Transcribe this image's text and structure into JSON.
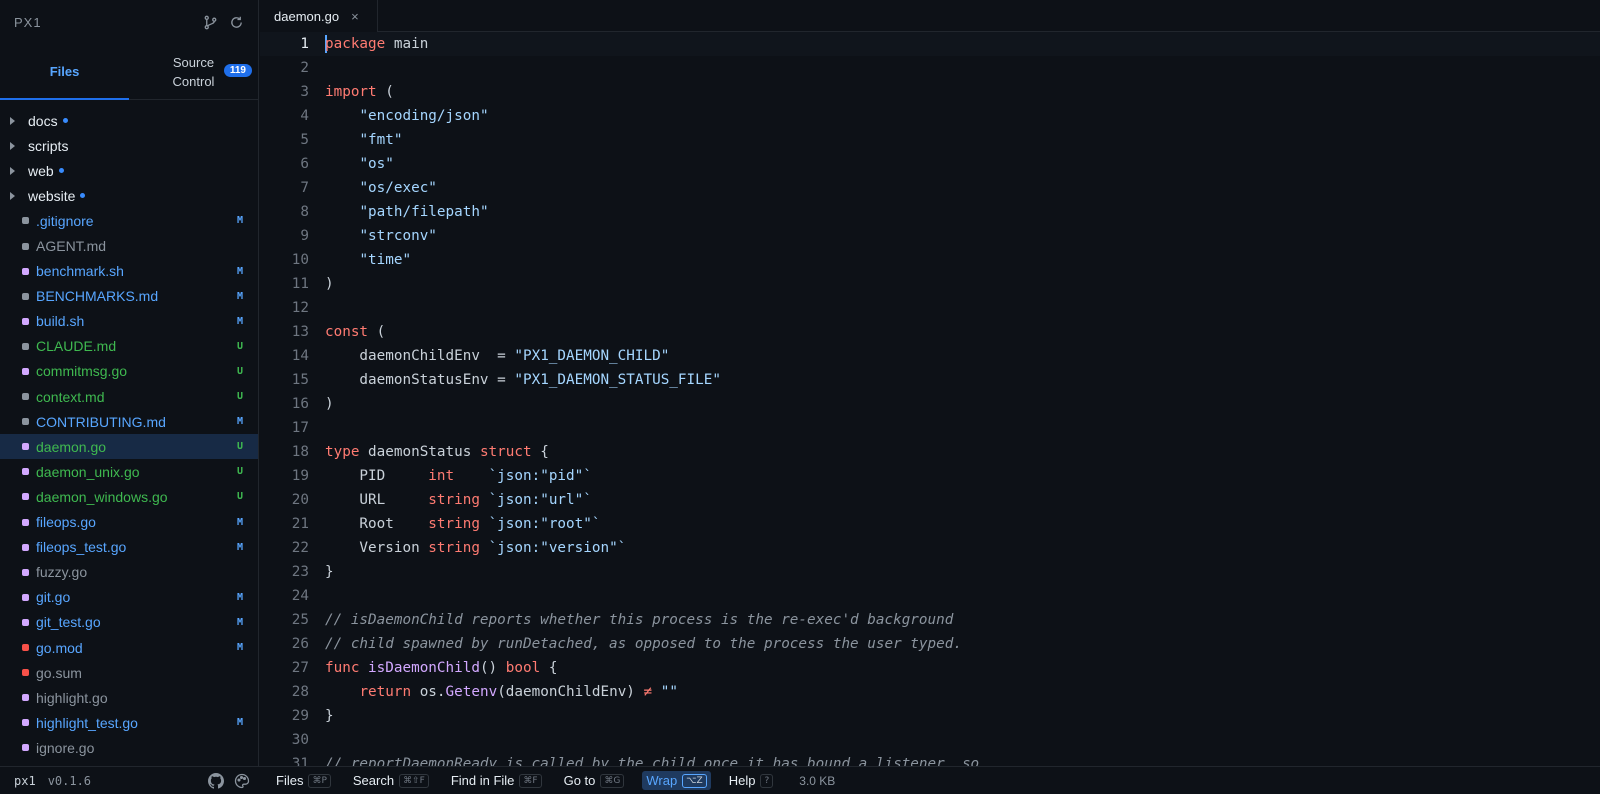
{
  "app": {
    "title": "PX1"
  },
  "sidebar": {
    "tabs": {
      "files": "Files",
      "source_control": "Source\nControl",
      "source_control_l1": "Source",
      "source_control_l2": "Control",
      "badge": "119"
    },
    "items": [
      {
        "type": "folder",
        "name": "docs",
        "dot": true
      },
      {
        "type": "folder",
        "name": "scripts",
        "dot": false
      },
      {
        "type": "folder",
        "name": "web",
        "dot": true
      },
      {
        "type": "folder",
        "name": "website",
        "dot": true
      },
      {
        "type": "file",
        "name": ".gitignore",
        "status": "M",
        "color": "#8b949e"
      },
      {
        "type": "file",
        "name": "AGENT.md",
        "status": "",
        "color": "#8b949e"
      },
      {
        "type": "file",
        "name": "benchmark.sh",
        "status": "M",
        "color": "#d2a8ff"
      },
      {
        "type": "file",
        "name": "BENCHMARKS.md",
        "status": "M",
        "color": "#8b949e"
      },
      {
        "type": "file",
        "name": "build.sh",
        "status": "M",
        "color": "#d2a8ff"
      },
      {
        "type": "file",
        "name": "CLAUDE.md",
        "status": "U",
        "color": "#8b949e"
      },
      {
        "type": "file",
        "name": "commitmsg.go",
        "status": "U",
        "color": "#d2a8ff"
      },
      {
        "type": "file",
        "name": "context.md",
        "status": "U",
        "color": "#8b949e"
      },
      {
        "type": "file",
        "name": "CONTRIBUTING.md",
        "status": "M",
        "color": "#8b949e"
      },
      {
        "type": "file",
        "name": "daemon.go",
        "status": "U",
        "color": "#d2a8ff",
        "selected": true
      },
      {
        "type": "file",
        "name": "daemon_unix.go",
        "status": "U",
        "color": "#d2a8ff"
      },
      {
        "type": "file",
        "name": "daemon_windows.go",
        "status": "U",
        "color": "#d2a8ff"
      },
      {
        "type": "file",
        "name": "fileops.go",
        "status": "M",
        "color": "#d2a8ff"
      },
      {
        "type": "file",
        "name": "fileops_test.go",
        "status": "M",
        "color": "#d2a8ff"
      },
      {
        "type": "file",
        "name": "fuzzy.go",
        "status": "",
        "color": "#d2a8ff"
      },
      {
        "type": "file",
        "name": "git.go",
        "status": "M",
        "color": "#d2a8ff"
      },
      {
        "type": "file",
        "name": "git_test.go",
        "status": "M",
        "color": "#d2a8ff"
      },
      {
        "type": "file",
        "name": "go.mod",
        "status": "M",
        "color": "#f85149"
      },
      {
        "type": "file",
        "name": "go.sum",
        "status": "",
        "color": "#f85149"
      },
      {
        "type": "file",
        "name": "highlight.go",
        "status": "",
        "color": "#d2a8ff"
      },
      {
        "type": "file",
        "name": "highlight_test.go",
        "status": "M",
        "color": "#d2a8ff"
      },
      {
        "type": "file",
        "name": "ignore.go",
        "status": "",
        "color": "#d2a8ff"
      }
    ]
  },
  "editor": {
    "tab": {
      "label": "daemon.go",
      "close": "×"
    },
    "current_line": 1,
    "lines": [
      [
        [
          "kw",
          "package"
        ],
        [
          "t",
          " main"
        ]
      ],
      [],
      [
        [
          "kw",
          "import"
        ],
        [
          "t",
          " ("
        ]
      ],
      [
        [
          "t",
          "    "
        ],
        [
          "str",
          "\"encoding/json\""
        ]
      ],
      [
        [
          "t",
          "    "
        ],
        [
          "str",
          "\"fmt\""
        ]
      ],
      [
        [
          "t",
          "    "
        ],
        [
          "str",
          "\"os\""
        ]
      ],
      [
        [
          "t",
          "    "
        ],
        [
          "str",
          "\"os/exec\""
        ]
      ],
      [
        [
          "t",
          "    "
        ],
        [
          "str",
          "\"path/filepath\""
        ]
      ],
      [
        [
          "t",
          "    "
        ],
        [
          "str",
          "\"strconv\""
        ]
      ],
      [
        [
          "t",
          "    "
        ],
        [
          "str",
          "\"time\""
        ]
      ],
      [
        [
          "t",
          ")"
        ]
      ],
      [],
      [
        [
          "kw",
          "const"
        ],
        [
          "t",
          " ("
        ]
      ],
      [
        [
          "t",
          "    daemonChildEnv  = "
        ],
        [
          "str",
          "\"PX1_DAEMON_CHILD\""
        ]
      ],
      [
        [
          "t",
          "    daemonStatusEnv = "
        ],
        [
          "str",
          "\"PX1_DAEMON_STATUS_FILE\""
        ]
      ],
      [
        [
          "t",
          ")"
        ]
      ],
      [],
      [
        [
          "kw",
          "type"
        ],
        [
          "t",
          " daemonStatus "
        ],
        [
          "kw",
          "struct"
        ],
        [
          "t",
          " {"
        ]
      ],
      [
        [
          "t",
          "    PID     "
        ],
        [
          "kw",
          "int"
        ],
        [
          "t",
          "    "
        ],
        [
          "str",
          "`json:\"pid\"`"
        ]
      ],
      [
        [
          "t",
          "    URL     "
        ],
        [
          "kw",
          "string"
        ],
        [
          "t",
          " "
        ],
        [
          "str",
          "`json:\"url\"`"
        ]
      ],
      [
        [
          "t",
          "    Root    "
        ],
        [
          "kw",
          "string"
        ],
        [
          "t",
          " "
        ],
        [
          "str",
          "`json:\"root\"`"
        ]
      ],
      [
        [
          "t",
          "    Version "
        ],
        [
          "kw",
          "string"
        ],
        [
          "t",
          " "
        ],
        [
          "str",
          "`json:\"version\"`"
        ]
      ],
      [
        [
          "t",
          "}"
        ]
      ],
      [],
      [
        [
          "cm",
          "// isDaemonChild reports whether this process is the re-exec'd background"
        ]
      ],
      [
        [
          "cm",
          "// child spawned by runDetached, as opposed to the process the user typed."
        ]
      ],
      [
        [
          "kw",
          "func"
        ],
        [
          "t",
          " "
        ],
        [
          "fn",
          "isDaemonChild"
        ],
        [
          "t",
          "() "
        ],
        [
          "kw",
          "bool"
        ],
        [
          "t",
          " {"
        ]
      ],
      [
        [
          "t",
          "    "
        ],
        [
          "kw",
          "return"
        ],
        [
          "t",
          " os."
        ],
        [
          "fn",
          "Getenv"
        ],
        [
          "t",
          "(daemonChildEnv) "
        ],
        [
          "kw",
          "≠"
        ],
        [
          "t",
          " "
        ],
        [
          "str",
          "\"\""
        ]
      ],
      [
        [
          "t",
          "}"
        ]
      ],
      [],
      [
        [
          "cm",
          "// reportDaemonReady is called by the child once it has bound a listener, so"
        ]
      ]
    ]
  },
  "statusbar": {
    "app_name": "px1",
    "version": "v0.1.6",
    "commands": [
      {
        "label": "Files",
        "key": "⌘P",
        "active": false
      },
      {
        "label": "Search",
        "key": "⌘⇧F",
        "active": false
      },
      {
        "label": "Find in File",
        "key": "⌘F",
        "active": false
      },
      {
        "label": "Go to",
        "key": "⌘G",
        "active": false
      },
      {
        "label": "Wrap",
        "key": "⌥Z",
        "active": true
      },
      {
        "label": "Help",
        "key": "?",
        "active": false
      }
    ],
    "file_size": "3.0 KB"
  }
}
